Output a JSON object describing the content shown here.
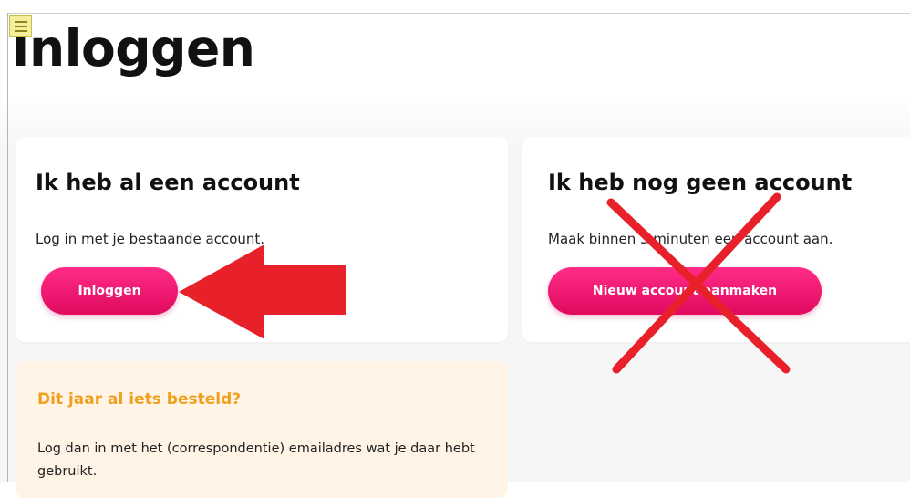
{
  "page": {
    "title": "Inloggen"
  },
  "login_card": {
    "heading": "Ik heb al een account",
    "description": "Log in met je bestaande account.",
    "button_label": "Inloggen"
  },
  "register_card": {
    "heading": "Ik heb nog geen account",
    "description": "Maak binnen 3 minuten een account aan.",
    "button_label": "Nieuw account aanmaken"
  },
  "notice_card": {
    "heading": "Dit jaar al iets besteld?",
    "body": "Log dan in met het (correspondentie) emailadres wat je daar hebt gebruikt."
  },
  "colors": {
    "accent_pink": "#e90d66",
    "notice_orange": "#f0a020",
    "notice_background": "#fff4e6",
    "annotation_red": "#e8202a"
  },
  "icons": {
    "menu": "hamburger-menu-icon"
  },
  "annotations": {
    "arrow": "red arrow pointing at login button",
    "cross": "red X over register card"
  }
}
